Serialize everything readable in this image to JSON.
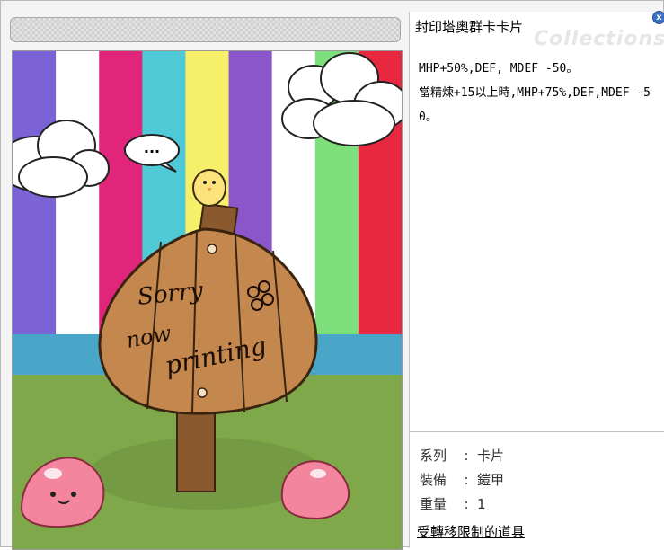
{
  "window": {
    "card_name": "封印塔奧群卡卡片",
    "watermark": "Collections",
    "close_icon": "close-icon",
    "close_glyph": "x"
  },
  "art": {
    "sign_text_line1": "Sorry",
    "sign_text_line2": "now",
    "sign_text_line3": "printing",
    "speech_text": "...",
    "stripe_colors": [
      "#7b63d6",
      "#ffffff",
      "#e0257a",
      "#4fc9d6",
      "#f5ef6a",
      "#8a56c9",
      "#ffffff",
      "#7ee07d",
      "#e8283f"
    ]
  },
  "description": {
    "line1": "MHP+50%,DEF, MDEF -50。",
    "line2": "當精煉+15以上時,MHP+75%,DEF,MDEF -50。"
  },
  "properties": [
    {
      "key": "系列",
      "sep": ":",
      "value": "卡片"
    },
    {
      "key": "裝備",
      "sep": ":",
      "value": "鎧甲"
    },
    {
      "key": "重量",
      "sep": ":",
      "value": "1"
    }
  ],
  "restriction_link": "受轉移限制的道具"
}
